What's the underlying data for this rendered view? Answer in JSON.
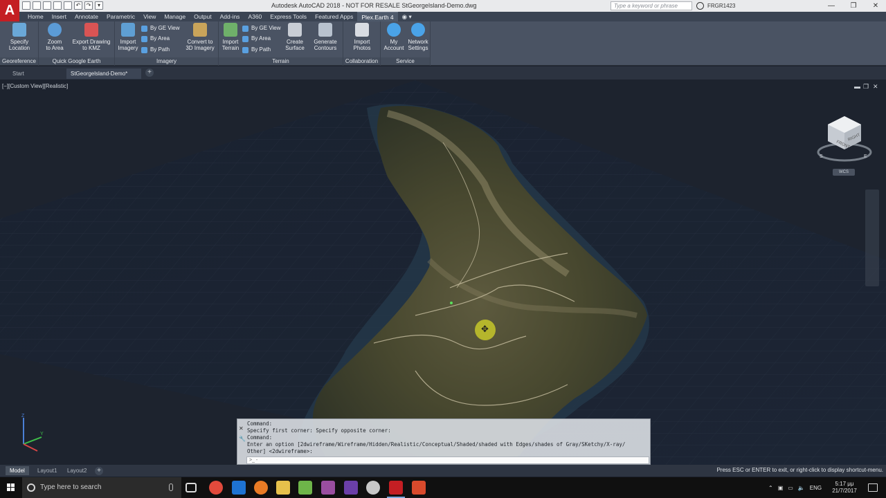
{
  "window": {
    "title": "Autodesk AutoCAD 2018 - NOT FOR RESALE    StGeorgelsland-Demo.dwg",
    "app_logo": "A",
    "search_placeholder": "Type a keyword or phrase",
    "user": "FRGR1423"
  },
  "ribbon_tabs": [
    "Home",
    "Insert",
    "Annotate",
    "Parametric",
    "View",
    "Manage",
    "Output",
    "Add-ins",
    "A360",
    "Express Tools",
    "Featured Apps",
    "Plex.Earth 4"
  ],
  "ribbon_active_tab": "Plex.Earth 4",
  "ribbon": {
    "georeference": {
      "title": "Georeference",
      "specify_location": "Specify\nLocation"
    },
    "quick_google_earth": {
      "title": "Quick Google Earth",
      "zoom_to_area": "Zoom\nto Area",
      "export_kmz": "Export Drawing\nto KMZ"
    },
    "imagery": {
      "title": "Imagery",
      "import_imagery": "Import\nImagery",
      "by_ge_view": "By GE View",
      "by_area": "By Area",
      "by_path": "By Path",
      "convert_3d": "Convert to\n3D Imagery"
    },
    "terrain": {
      "title": "Terrain",
      "import_terrain": "Import\nTerrain",
      "by_ge_view": "By GE View",
      "by_area": "By Area",
      "by_path": "By Path",
      "create_surface": "Create\nSurface",
      "generate_contours": "Generate\nContours"
    },
    "collaboration": {
      "title": "Collaboration",
      "import_photos": "Import\nPhotos"
    },
    "service": {
      "title": "Service",
      "my_account": "My\nAccount",
      "network_settings": "Network\nSettings"
    }
  },
  "doc_tabs": {
    "start": "Start",
    "active": "StGeorgelsland-Demo*"
  },
  "viewport": {
    "label": "[−][Custom View][Realistic]",
    "viewcube_front": "FRONT",
    "viewcube_right": "RIGHT",
    "compass_s": "S",
    "compass_e": "E",
    "wcs": "WCS",
    "ucs_z": "Z",
    "ucs_y": "Y"
  },
  "command_line": {
    "history": [
      "Command:",
      "Specify first corner:  Specify opposite corner:",
      "Command:",
      "Enter an option [2dwireframe/Wireframe/Hidden/Realistic/Conceptual/Shaded/shaded with Edges/shades of Gray/SKetchy/X-ray/",
      "Other] <2dwireframe>:"
    ],
    "input_prompt": ">_ -"
  },
  "layout_tabs": [
    "Model",
    "Layout1",
    "Layout2"
  ],
  "layout_active": "Model",
  "status_message": "Press ESC or ENTER to exit, or right-click to display shortcut-menu.",
  "taskbar": {
    "search_placeholder": "Type here to search",
    "language": "ENG",
    "time": "5:17 μμ",
    "date": "21/7/2017"
  },
  "icons": {
    "start": "windows-logo-icon",
    "search": "search-icon",
    "mic": "microphone-icon",
    "task_view": "task-view-icon"
  },
  "colors": {
    "autocad_red": "#c41e23",
    "ribbon_bg": "#4a5363",
    "viewport_bg": "#1d232e",
    "cursor": "#c5c72a"
  }
}
